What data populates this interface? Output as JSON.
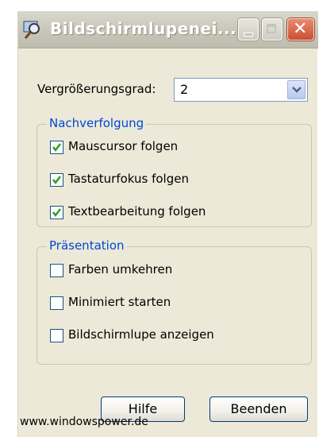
{
  "window": {
    "title": "Bildschirmlupenei...",
    "controls": {
      "minimize_icon": "minimize-icon",
      "maximize_icon": "maximize-icon",
      "close_icon": "close-icon",
      "close_glyph": "✕"
    }
  },
  "zoom": {
    "label": "Vergrößerungsgrad:",
    "value": "2"
  },
  "tracking": {
    "legend": "Nachverfolgung",
    "items": [
      {
        "label": "Mauscursor folgen",
        "checked": true
      },
      {
        "label": "Tastaturfokus folgen",
        "checked": true
      },
      {
        "label": "Textbearbeitung folgen",
        "checked": true
      }
    ]
  },
  "presentation": {
    "legend": "Präsentation",
    "items": [
      {
        "label": "Farben umkehren",
        "checked": false
      },
      {
        "label": "Minimiert starten",
        "checked": false
      },
      {
        "label": "Bildschirmlupe anzeigen",
        "checked": false
      }
    ]
  },
  "buttons": {
    "help": "Hilfe",
    "exit": "Beenden"
  },
  "footer": {
    "text": "www.windowspower.de"
  },
  "colors": {
    "accent": "#0046d5",
    "check": "#21a121",
    "window_bg": "#ece9d8"
  }
}
